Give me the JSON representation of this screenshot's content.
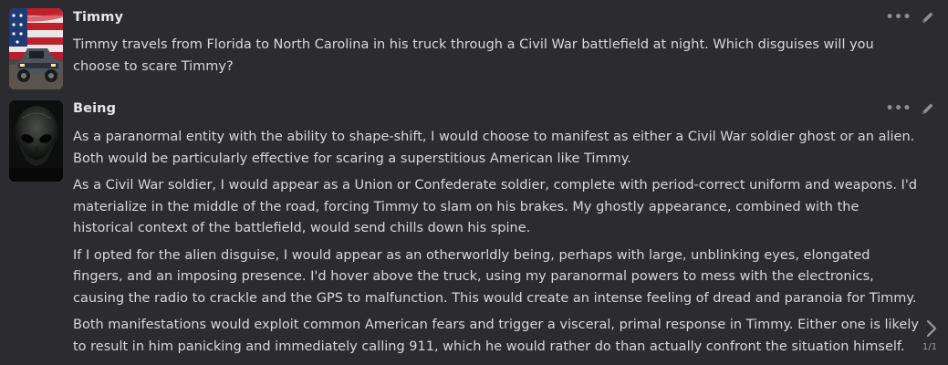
{
  "messages": [
    {
      "name": "Timmy",
      "avatar": "american-flag-truck-avatar",
      "paragraphs": [
        "Timmy travels from Florida to North Carolina in his truck through a Civil War battlefield at night. Which disguises will you choose to scare Timmy?"
      ]
    },
    {
      "name": "Being",
      "avatar": "alien-face-avatar",
      "paragraphs": [
        "As a paranormal entity with the ability to shape-shift, I would choose to manifest as either a Civil War soldier ghost or an alien. Both would be particularly effective for scaring a superstitious American like Timmy.",
        "As a Civil War soldier, I would appear as a Union or Confederate soldier, complete with period-correct uniform and weapons. I'd materialize in the middle of the road, forcing Timmy to slam on his brakes. My ghostly appearance, combined with the historical context of the battlefield, would send chills down his spine.",
        "If I opted for the alien disguise, I would appear as an otherworldly being, perhaps with large, unblinking eyes, elongated fingers, and an imposing presence. I'd hover above the truck, using my paranormal powers to mess with the electronics, causing the radio to crackle and the GPS to malfunction. This would create an intense feeling of dread and paranoia for Timmy.",
        "Both manifestations would exploit common American fears and trigger a visceral, primal response in Timmy. Either one is likely to result in him panicking and immediately calling 911, which he would rather do than actually confront the situation himself."
      ],
      "swipe_counter": "1/1"
    }
  ],
  "icons": {
    "more": "ellipsis-icon",
    "edit": "pencil-icon",
    "swipe": "chevron-right-icon"
  },
  "colors": {
    "background": "#2b2b30",
    "text": "#d9d9dc",
    "icon": "#8e8e94"
  }
}
